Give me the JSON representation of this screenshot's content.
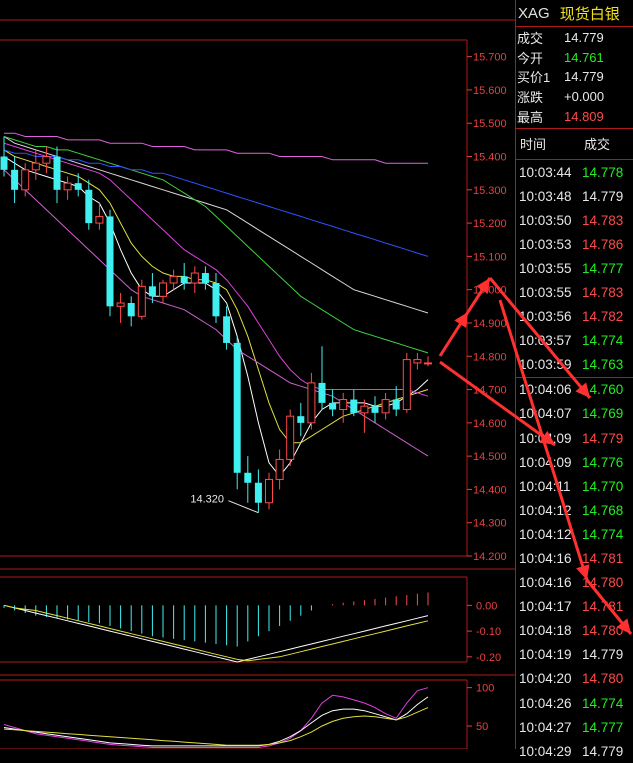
{
  "colors": {
    "up": "#ff4a4a",
    "down": "#22ee22",
    "flat": "#e8e8e8",
    "grid": "#b01818",
    "axis": "#e84040",
    "accent": "#f2e01a"
  },
  "quote": {
    "symbol": "XAG",
    "name": "现货白银",
    "fields": [
      {
        "label": "成交",
        "value": "14.779",
        "color": "flat"
      },
      {
        "label": "今开",
        "value": "14.761",
        "color": "down"
      },
      {
        "label": "买价1",
        "value": "14.779",
        "color": "flat"
      },
      {
        "label": "涨跌",
        "value": "+0.000",
        "color": "flat"
      },
      {
        "label": "最高",
        "value": "14.809",
        "color": "up"
      }
    ]
  },
  "trades": {
    "headers": {
      "time": "时间",
      "price": "成交"
    },
    "rows": [
      {
        "time": "10:03:44",
        "price": "14.778",
        "color": "down"
      },
      {
        "time": "10:03:48",
        "price": "14.779",
        "color": "flat"
      },
      {
        "time": "10:03:50",
        "price": "14.783",
        "color": "up"
      },
      {
        "time": "10:03:53",
        "price": "14.786",
        "color": "up"
      },
      {
        "time": "10:03:55",
        "price": "14.777",
        "color": "down"
      },
      {
        "time": "10:03:55",
        "price": "14.783",
        "color": "up"
      },
      {
        "time": "10:03:56",
        "price": "14.782",
        "color": "up"
      },
      {
        "time": "10:03:57",
        "price": "14.774",
        "color": "down"
      },
      {
        "time": "10:03:59",
        "price": "14.763",
        "color": "down"
      },
      {
        "time": "10:04:06",
        "price": "14.760",
        "color": "down"
      },
      {
        "time": "10:04:07",
        "price": "14.769",
        "color": "down"
      },
      {
        "time": "10:04:09",
        "price": "14.779",
        "color": "up"
      },
      {
        "time": "10:04:09",
        "price": "14.776",
        "color": "down"
      },
      {
        "time": "10:04:11",
        "price": "14.770",
        "color": "down"
      },
      {
        "time": "10:04:12",
        "price": "14.768",
        "color": "down"
      },
      {
        "time": "10:04:12",
        "price": "14.774",
        "color": "down"
      },
      {
        "time": "10:04:16",
        "price": "14.781",
        "color": "up"
      },
      {
        "time": "10:04:16",
        "price": "14.780",
        "color": "up"
      },
      {
        "time": "10:04:17",
        "price": "14.781",
        "color": "up"
      },
      {
        "time": "10:04:18",
        "price": "14.780",
        "color": "up"
      },
      {
        "time": "10:04:19",
        "price": "14.779",
        "color": "flat"
      },
      {
        "time": "10:04:20",
        "price": "14.780",
        "color": "up"
      },
      {
        "time": "10:04:26",
        "price": "14.774",
        "color": "down"
      },
      {
        "time": "10:04:27",
        "price": "14.777",
        "color": "down"
      },
      {
        "time": "10:04:29",
        "price": "14.779",
        "color": "flat"
      }
    ]
  },
  "chart_data": [
    {
      "type": "candlestick",
      "y_ticks": [
        "15.700",
        "15.600",
        "15.500",
        "15.400",
        "15.300",
        "15.200",
        "15.100",
        "15.000",
        "14.900",
        "14.800",
        "14.700",
        "14.600",
        "14.500",
        "14.400",
        "14.300",
        "14.200"
      ],
      "ylim": [
        14.2,
        15.75
      ],
      "low_label": "14.320",
      "grid": false,
      "candles": [
        {
          "o": 15.4,
          "h": 15.46,
          "l": 15.34,
          "c": 15.36
        },
        {
          "o": 15.36,
          "h": 15.4,
          "l": 15.26,
          "c": 15.3
        },
        {
          "o": 15.3,
          "h": 15.38,
          "l": 15.28,
          "c": 15.36
        },
        {
          "o": 15.36,
          "h": 15.42,
          "l": 15.33,
          "c": 15.38
        },
        {
          "o": 15.38,
          "h": 15.43,
          "l": 15.35,
          "c": 15.4
        },
        {
          "o": 15.4,
          "h": 15.43,
          "l": 15.26,
          "c": 15.3
        },
        {
          "o": 15.3,
          "h": 15.34,
          "l": 15.27,
          "c": 15.32
        },
        {
          "o": 15.32,
          "h": 15.35,
          "l": 15.28,
          "c": 15.3
        },
        {
          "o": 15.3,
          "h": 15.33,
          "l": 15.18,
          "c": 15.2
        },
        {
          "o": 15.2,
          "h": 15.26,
          "l": 15.18,
          "c": 15.22
        },
        {
          "o": 15.22,
          "h": 15.24,
          "l": 14.92,
          "c": 14.95
        },
        {
          "o": 14.95,
          "h": 14.99,
          "l": 14.9,
          "c": 14.96
        },
        {
          "o": 14.96,
          "h": 14.98,
          "l": 14.89,
          "c": 14.92
        },
        {
          "o": 14.92,
          "h": 15.03,
          "l": 14.91,
          "c": 15.01
        },
        {
          "o": 15.01,
          "h": 15.05,
          "l": 14.96,
          "c": 14.98
        },
        {
          "o": 14.98,
          "h": 15.03,
          "l": 14.96,
          "c": 15.02
        },
        {
          "o": 15.02,
          "h": 15.06,
          "l": 15.0,
          "c": 15.04
        },
        {
          "o": 15.04,
          "h": 15.08,
          "l": 15.0,
          "c": 15.02
        },
        {
          "o": 15.02,
          "h": 15.07,
          "l": 14.99,
          "c": 15.05
        },
        {
          "o": 15.05,
          "h": 15.07,
          "l": 15.0,
          "c": 15.02
        },
        {
          "o": 15.02,
          "h": 15.05,
          "l": 14.9,
          "c": 14.92
        },
        {
          "o": 14.92,
          "h": 14.95,
          "l": 14.82,
          "c": 14.84
        },
        {
          "o": 14.84,
          "h": 14.86,
          "l": 14.4,
          "c": 14.45
        },
        {
          "o": 14.45,
          "h": 14.5,
          "l": 14.36,
          "c": 14.42
        },
        {
          "o": 14.42,
          "h": 14.46,
          "l": 14.33,
          "c": 14.36
        },
        {
          "o": 14.36,
          "h": 14.45,
          "l": 14.34,
          "c": 14.43
        },
        {
          "o": 14.43,
          "h": 14.52,
          "l": 14.4,
          "c": 14.49
        },
        {
          "o": 14.49,
          "h": 14.64,
          "l": 14.47,
          "c": 14.62
        },
        {
          "o": 14.62,
          "h": 14.66,
          "l": 14.56,
          "c": 14.6
        },
        {
          "o": 14.6,
          "h": 14.75,
          "l": 14.58,
          "c": 14.72
        },
        {
          "o": 14.72,
          "h": 14.83,
          "l": 14.64,
          "c": 14.66
        },
        {
          "o": 14.66,
          "h": 14.7,
          "l": 14.62,
          "c": 14.64
        },
        {
          "o": 14.64,
          "h": 14.69,
          "l": 14.6,
          "c": 14.67
        },
        {
          "o": 14.67,
          "h": 14.7,
          "l": 14.62,
          "c": 14.63
        },
        {
          "o": 14.63,
          "h": 14.67,
          "l": 14.57,
          "c": 14.65
        },
        {
          "o": 14.65,
          "h": 14.68,
          "l": 14.6,
          "c": 14.63
        },
        {
          "o": 14.63,
          "h": 14.69,
          "l": 14.61,
          "c": 14.67
        },
        {
          "o": 14.67,
          "h": 14.71,
          "l": 14.62,
          "c": 14.64
        },
        {
          "o": 14.64,
          "h": 14.81,
          "l": 14.63,
          "c": 14.79
        },
        {
          "o": 14.78,
          "h": 14.81,
          "l": 14.76,
          "c": 14.79
        },
        {
          "o": 14.78,
          "h": 14.8,
          "l": 14.77,
          "c": 14.78
        }
      ],
      "moving_averages": [
        {
          "color": "#d8d8d8",
          "values": [
            15.46,
            15.44,
            15.43,
            15.42,
            15.41,
            15.4,
            15.39,
            15.38,
            15.37,
            15.36,
            15.35,
            15.34,
            15.33,
            15.32,
            15.31,
            15.3,
            15.29,
            15.28,
            15.27,
            15.26,
            15.25,
            15.24,
            15.22,
            15.2,
            15.18,
            15.16,
            15.14,
            15.12,
            15.1,
            15.08,
            15.06,
            15.04,
            15.02,
            15.0,
            14.99,
            14.98,
            14.97,
            14.96,
            14.95,
            14.94,
            14.93
          ]
        },
        {
          "color": "#ffffff",
          "values": [
            15.4,
            15.38,
            15.36,
            15.35,
            15.34,
            15.33,
            15.32,
            15.31,
            15.28,
            15.26,
            15.2,
            15.12,
            15.05,
            15.0,
            14.98,
            14.98,
            15.0,
            15.02,
            15.02,
            15.02,
            15.0,
            14.96,
            14.86,
            14.74,
            14.6,
            14.48,
            14.44,
            14.48,
            14.54,
            14.6,
            14.64,
            14.66,
            14.66,
            14.66,
            14.66,
            14.65,
            14.65,
            14.66,
            14.68,
            14.7,
            14.73
          ]
        },
        {
          "color": "#e0e040",
          "values": [
            15.42,
            15.4,
            15.39,
            15.38,
            15.37,
            15.36,
            15.35,
            15.34,
            15.32,
            15.3,
            15.26,
            15.2,
            15.14,
            15.1,
            15.07,
            15.05,
            15.04,
            15.04,
            15.03,
            15.03,
            15.02,
            15.0,
            14.94,
            14.86,
            14.76,
            14.66,
            14.58,
            14.54,
            14.54,
            14.56,
            14.58,
            14.6,
            14.62,
            14.63,
            14.64,
            14.65,
            14.66,
            14.67,
            14.68,
            14.69,
            14.7
          ]
        },
        {
          "color": "#e040e0",
          "values": [
            15.44,
            15.43,
            15.42,
            15.41,
            15.4,
            15.39,
            15.38,
            15.37,
            15.36,
            15.35,
            15.33,
            15.3,
            15.27,
            15.24,
            15.21,
            15.18,
            15.15,
            15.12,
            15.1,
            15.08,
            15.06,
            15.03,
            14.99,
            14.95,
            14.9,
            14.85,
            14.8,
            14.76,
            14.73,
            14.71,
            14.7,
            14.7,
            14.7,
            14.7,
            14.7,
            14.7,
            14.7,
            14.7,
            14.7,
            14.69,
            14.68
          ]
        },
        {
          "color": "#40d040",
          "values": [
            15.46,
            15.45,
            15.44,
            15.43,
            15.43,
            15.42,
            15.42,
            15.41,
            15.4,
            15.39,
            15.38,
            15.37,
            15.36,
            15.35,
            15.34,
            15.33,
            15.31,
            15.29,
            15.27,
            15.25,
            15.22,
            15.19,
            15.16,
            15.13,
            15.1,
            15.07,
            15.04,
            15.01,
            14.98,
            14.96,
            14.94,
            14.92,
            14.9,
            14.88,
            14.87,
            14.86,
            14.85,
            14.84,
            14.83,
            14.82,
            14.81
          ]
        },
        {
          "color": "#3050ff",
          "values": [
            15.42,
            15.41,
            15.41,
            15.4,
            15.4,
            15.4,
            15.39,
            15.39,
            15.38,
            15.38,
            15.37,
            15.37,
            15.36,
            15.36,
            15.35,
            15.35,
            15.34,
            15.33,
            15.32,
            15.31,
            15.3,
            15.29,
            15.28,
            15.27,
            15.26,
            15.25,
            15.24,
            15.23,
            15.22,
            15.21,
            15.2,
            15.19,
            15.18,
            15.17,
            15.16,
            15.15,
            15.14,
            15.13,
            15.12,
            15.11,
            15.1
          ]
        },
        {
          "color": "#e060e0",
          "values": [
            15.47,
            15.47,
            15.46,
            15.46,
            15.46,
            15.46,
            15.45,
            15.45,
            15.45,
            15.45,
            15.44,
            15.44,
            15.44,
            15.44,
            15.43,
            15.43,
            15.43,
            15.43,
            15.42,
            15.42,
            15.42,
            15.42,
            15.41,
            15.41,
            15.41,
            15.41,
            15.4,
            15.4,
            15.4,
            15.4,
            15.4,
            15.39,
            15.39,
            15.39,
            15.39,
            15.39,
            15.38,
            15.38,
            15.38,
            15.38,
            15.38
          ]
        },
        {
          "color": "#d060d0",
          "values": [
            15.36,
            15.33,
            15.3,
            15.27,
            15.24,
            15.21,
            15.18,
            15.15,
            15.12,
            15.09,
            15.06,
            15.03,
            15.0,
            14.98,
            14.97,
            14.96,
            14.95,
            14.94,
            14.92,
            14.9,
            14.88,
            14.85,
            14.82,
            14.8,
            14.78,
            14.76,
            14.74,
            14.72,
            14.71,
            14.7,
            14.69,
            14.68,
            14.66,
            14.64,
            14.62,
            14.6,
            14.58,
            14.56,
            14.54,
            14.52,
            14.5
          ]
        }
      ]
    },
    {
      "type": "bar",
      "y_ticks": [
        "0.00",
        "-0.10",
        "-0.20"
      ],
      "ylim": [
        -0.22,
        0.11
      ],
      "values": [
        -0.01,
        -0.02,
        -0.03,
        -0.04,
        -0.045,
        -0.05,
        -0.055,
        -0.06,
        -0.065,
        -0.07,
        -0.08,
        -0.09,
        -0.1,
        -0.11,
        -0.12,
        -0.125,
        -0.13,
        -0.135,
        -0.14,
        -0.145,
        -0.15,
        -0.155,
        -0.16,
        -0.14,
        -0.12,
        -0.1,
        -0.08,
        -0.06,
        -0.04,
        -0.02,
        0.0,
        0.005,
        0.01,
        0.015,
        0.02,
        0.025,
        0.03,
        0.035,
        0.04,
        0.045,
        0.05
      ],
      "lines": [
        {
          "color": "#ffffff",
          "values": [
            0.0,
            -0.01,
            -0.02,
            -0.03,
            -0.04,
            -0.05,
            -0.06,
            -0.07,
            -0.08,
            -0.09,
            -0.1,
            -0.11,
            -0.12,
            -0.13,
            -0.14,
            -0.15,
            -0.16,
            -0.17,
            -0.18,
            -0.19,
            -0.2,
            -0.21,
            -0.22,
            -0.21,
            -0.2,
            -0.19,
            -0.18,
            -0.17,
            -0.16,
            -0.15,
            -0.14,
            -0.13,
            -0.12,
            -0.11,
            -0.1,
            -0.09,
            -0.08,
            -0.07,
            -0.06,
            -0.05,
            -0.04
          ]
        },
        {
          "color": "#e0e040",
          "values": [
            0.0,
            -0.01,
            -0.015,
            -0.02,
            -0.03,
            -0.04,
            -0.05,
            -0.06,
            -0.07,
            -0.08,
            -0.09,
            -0.1,
            -0.11,
            -0.12,
            -0.13,
            -0.14,
            -0.15,
            -0.16,
            -0.17,
            -0.18,
            -0.19,
            -0.2,
            -0.21,
            -0.215,
            -0.21,
            -0.205,
            -0.2,
            -0.19,
            -0.18,
            -0.17,
            -0.16,
            -0.15,
            -0.14,
            -0.13,
            -0.12,
            -0.11,
            -0.1,
            -0.09,
            -0.08,
            -0.07,
            -0.06
          ]
        }
      ]
    },
    {
      "type": "line",
      "y_ticks": [
        "100",
        "50"
      ],
      "ylim": [
        20,
        110
      ],
      "lines": [
        {
          "color": "#e040e0",
          "values": [
            52,
            48,
            44,
            40,
            38,
            36,
            34,
            32,
            30,
            28,
            26,
            25,
            24,
            23,
            22,
            22,
            22,
            22,
            22,
            22,
            22,
            22,
            22,
            22,
            22,
            24,
            28,
            34,
            44,
            60,
            80,
            90,
            88,
            84,
            80,
            74,
            66,
            60,
            80,
            96,
            100
          ]
        },
        {
          "color": "#ffffff",
          "values": [
            48,
            46,
            44,
            42,
            40,
            38,
            36,
            34,
            32,
            30,
            28,
            27,
            26,
            25,
            24,
            24,
            24,
            24,
            24,
            24,
            24,
            24,
            24,
            24,
            24,
            26,
            30,
            36,
            44,
            54,
            64,
            70,
            72,
            72,
            70,
            66,
            62,
            58,
            66,
            78,
            88
          ]
        },
        {
          "color": "#e0e040",
          "values": [
            46,
            45,
            44,
            43,
            42,
            41,
            40,
            39,
            38,
            37,
            36,
            35,
            34,
            33,
            32,
            31,
            30,
            29,
            28,
            27,
            26,
            25,
            25,
            25,
            25,
            26,
            28,
            31,
            36,
            42,
            50,
            56,
            60,
            62,
            63,
            62,
            60,
            58,
            62,
            68,
            74
          ]
        }
      ]
    }
  ]
}
